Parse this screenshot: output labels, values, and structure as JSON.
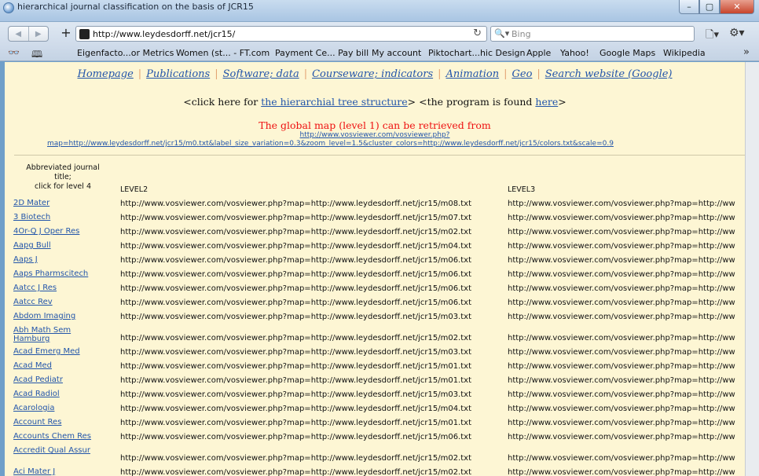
{
  "window": {
    "title": "hierarchical journal classification on the basis of JCR15",
    "min_label": "–",
    "max_label": "▢",
    "close_label": "✕"
  },
  "toolbar": {
    "url": "http://www.leydesdorff.net/jcr15/",
    "search_placeholder": "Bing",
    "back_glyph": "◀",
    "forward_glyph": "▶",
    "plus_glyph": "+",
    "reload_glyph": "↻",
    "search_glyph": "🔍▾",
    "page_glyph": "🗋▾",
    "tools_glyph": "⚙▾"
  },
  "bookmarks": {
    "reader_glyph": "👓",
    "book_glyph": "🕮",
    "items": [
      "Eigenfacto...or Metrics",
      "Women (st... - FT.com",
      "Payment Ce... Pay bill",
      "My account",
      "Piktochart...hic Design",
      "Apple",
      "Yahoo!",
      "Google Maps",
      "Wikipedia"
    ],
    "more_glyph": "»"
  },
  "nav": {
    "items": [
      "Homepage",
      "Publications",
      "Software; data",
      "Courseware; indicators",
      "Animation",
      "Geo",
      "Search website (Google)"
    ],
    "sep": "|"
  },
  "tree": {
    "prefix": "<click here for ",
    "link": "the hierarchial tree structure",
    "middle": ">  <the program is found ",
    "here": "here",
    "suffix": ">"
  },
  "global": {
    "text": "The global map (level 1) can be retrieved from",
    "link1": "http://www.vosviewer.com/vosviewer.php?",
    "link2": "map=http://www.leydesdorff.net/jcr15/m0.txt&label_size_variation=0.3&zoom_level=1.5&cluster_colors=http://www.leydesdorff.net/jcr15/colors.txt&scale=0.9"
  },
  "table": {
    "header_title_1": "Abbreviated journal",
    "header_title_2": "title;",
    "header_title_3": "click for level 4",
    "header_l2": "LEVEL2",
    "header_l3": "LEVEL3",
    "l3_text": "http://www.vosviewer.com/vosviewer.php?map=http://ww",
    "rows": [
      {
        "name": "2D Mater",
        "l2": "http://www.vosviewer.com/vosviewer.php?map=http://www.leydesdorff.net/jcr15/m08.txt"
      },
      {
        "name": "3 Biotech",
        "l2": "http://www.vosviewer.com/vosviewer.php?map=http://www.leydesdorff.net/jcr15/m07.txt"
      },
      {
        "name": "4Or-Q J Oper Res",
        "l2": "http://www.vosviewer.com/vosviewer.php?map=http://www.leydesdorff.net/jcr15/m02.txt"
      },
      {
        "name": "Aapg Bull",
        "l2": "http://www.vosviewer.com/vosviewer.php?map=http://www.leydesdorff.net/jcr15/m04.txt"
      },
      {
        "name": "Aaps J",
        "l2": "http://www.vosviewer.com/vosviewer.php?map=http://www.leydesdorff.net/jcr15/m06.txt"
      },
      {
        "name": "Aaps Pharmscitech",
        "l2": "http://www.vosviewer.com/vosviewer.php?map=http://www.leydesdorff.net/jcr15/m06.txt"
      },
      {
        "name": "Aatcc J Res",
        "l2": "http://www.vosviewer.com/vosviewer.php?map=http://www.leydesdorff.net/jcr15/m06.txt"
      },
      {
        "name": "Aatcc Rev",
        "l2": "http://www.vosviewer.com/vosviewer.php?map=http://www.leydesdorff.net/jcr15/m06.txt"
      },
      {
        "name": "Abdom Imaging",
        "l2": "http://www.vosviewer.com/vosviewer.php?map=http://www.leydesdorff.net/jcr15/m03.txt"
      },
      {
        "name": "Abh Math Sem Hamburg",
        "l2": "http://www.vosviewer.com/vosviewer.php?map=http://www.leydesdorff.net/jcr15/m02.txt"
      },
      {
        "name": "Acad Emerg Med",
        "l2": "http://www.vosviewer.com/vosviewer.php?map=http://www.leydesdorff.net/jcr15/m03.txt"
      },
      {
        "name": "Acad Med",
        "l2": "http://www.vosviewer.com/vosviewer.php?map=http://www.leydesdorff.net/jcr15/m01.txt"
      },
      {
        "name": "Acad Pediatr",
        "l2": "http://www.vosviewer.com/vosviewer.php?map=http://www.leydesdorff.net/jcr15/m01.txt"
      },
      {
        "name": "Acad Radiol",
        "l2": "http://www.vosviewer.com/vosviewer.php?map=http://www.leydesdorff.net/jcr15/m03.txt"
      },
      {
        "name": "Acarologia",
        "l2": "http://www.vosviewer.com/vosviewer.php?map=http://www.leydesdorff.net/jcr15/m04.txt"
      },
      {
        "name": "Account Res",
        "l2": "http://www.vosviewer.com/vosviewer.php?map=http://www.leydesdorff.net/jcr15/m01.txt"
      },
      {
        "name": "Accounts Chem Res",
        "l2": "http://www.vosviewer.com/vosviewer.php?map=http://www.leydesdorff.net/jcr15/m06.txt"
      },
      {
        "name": "Accredit Qual Assur",
        "l2": "http://www.vosviewer.com/vosviewer.php?map=http://www.leydesdorff.net/jcr15/m02.txt"
      },
      {
        "name": "Aci Mater J",
        "l2": "http://www.vosviewer.com/vosviewer.php?map=http://www.leydesdorff.net/jcr15/m02.txt"
      }
    ]
  }
}
